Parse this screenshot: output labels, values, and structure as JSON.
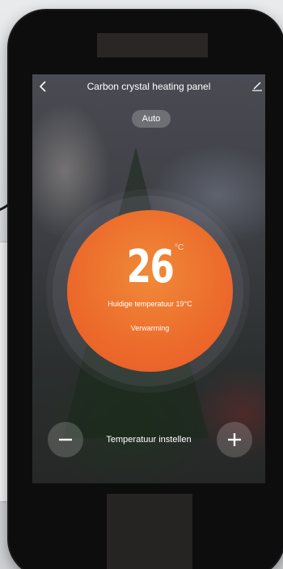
{
  "header": {
    "back_icon": "chevron-left-icon",
    "title": "Carbon crystal heating panel",
    "edit_icon": "pencil-icon"
  },
  "mode": {
    "label": "Auto"
  },
  "thermostat": {
    "setpoint": "26",
    "unit": "°C",
    "current_label": "Huidige temperatuur 19°C",
    "status": "Verwarming",
    "accent_color": "#ec6a2b"
  },
  "controls": {
    "minus_icon": "minus-icon",
    "plus_icon": "plus-icon",
    "label": "Temperatuur instellen"
  }
}
